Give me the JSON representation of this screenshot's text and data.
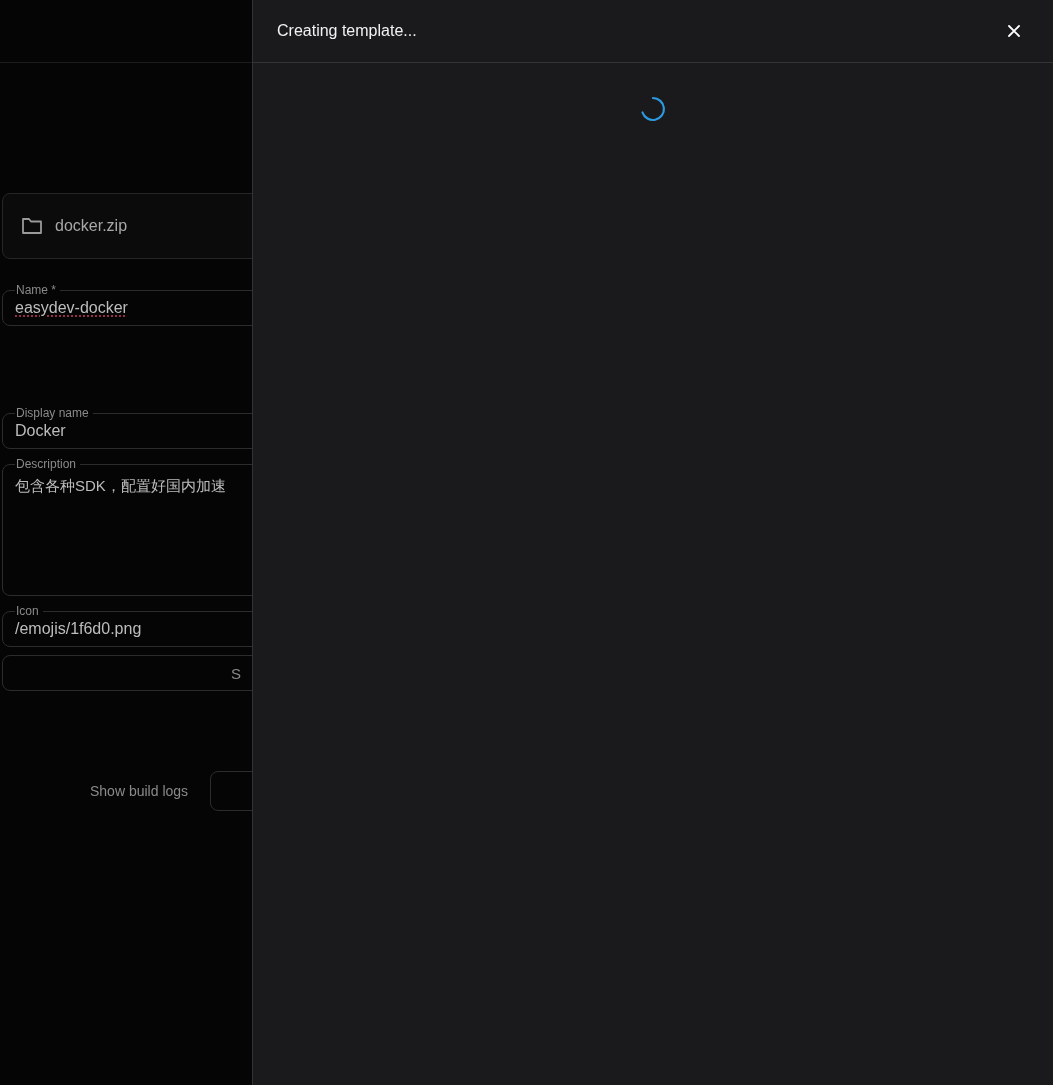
{
  "background_form": {
    "file": {
      "name": "docker.zip"
    },
    "fields": [
      {
        "kind": "text",
        "label": "Name *",
        "value": "easydev-docker",
        "misspelled": true
      },
      {
        "kind": "text",
        "label": "Display name",
        "value": "Docker",
        "misspelled": false
      },
      {
        "kind": "textarea",
        "label": "Description",
        "value": "包含各种SDK，配置好国内加速",
        "misspelled": false
      },
      {
        "kind": "text",
        "label": "Icon",
        "value": "/emojis/1f6d0.png",
        "misspelled": false
      }
    ],
    "button": "S",
    "build_logs_label": "Show build logs"
  },
  "drawer": {
    "title": "Creating template...",
    "loading": true
  }
}
